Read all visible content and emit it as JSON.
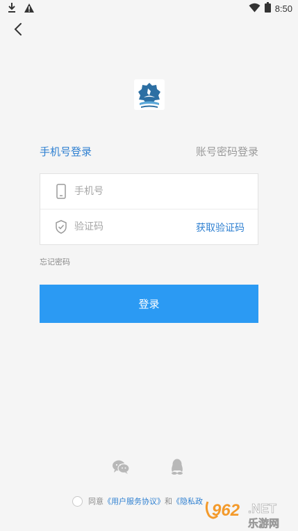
{
  "status_bar": {
    "time": "8:50",
    "icons": [
      "download-icon",
      "warning-icon",
      "wifi-icon",
      "battery-icon"
    ]
  },
  "header": {
    "back_icon": "back-arrow-icon"
  },
  "logo": {
    "icon": "app-logo"
  },
  "tabs": {
    "phone_login": "手机号登录",
    "account_login": "账号密码登录"
  },
  "form": {
    "phone_placeholder": "手机号",
    "code_placeholder": "验证码",
    "get_code_label": "获取验证码"
  },
  "forgot_password": "忘记密码",
  "login_button": "登录",
  "social": {
    "wechat_icon": "wechat-icon",
    "qq_icon": "qq-icon"
  },
  "agreement": {
    "prefix": "同意",
    "user_agreement": "《用户服务协议》",
    "and": "和",
    "privacy_partial": "《隐私政"
  },
  "watermark": {
    "brand": "962",
    "suffix": ".NET",
    "subtitle": "乐游网"
  },
  "colors": {
    "accent": "#2f80d1",
    "button": "#2b9af3",
    "background": "#f5f5f5"
  }
}
